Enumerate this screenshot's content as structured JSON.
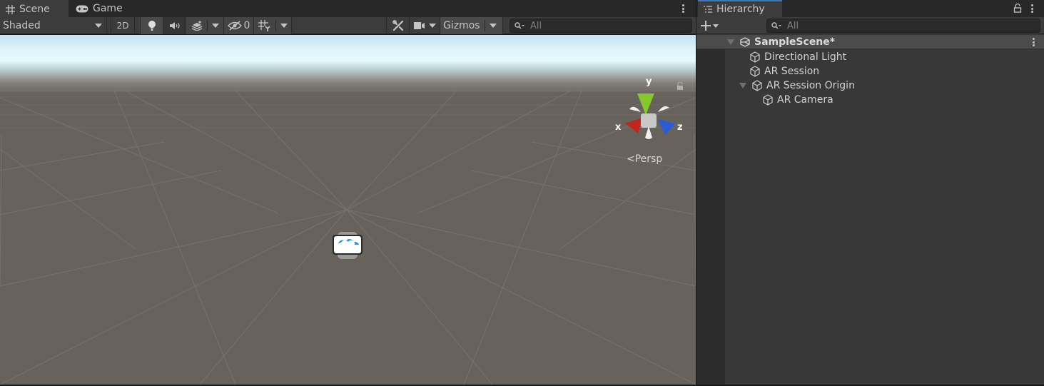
{
  "scene_view": {
    "tabs": [
      {
        "label": "Scene",
        "icon": "grid-hash-icon",
        "active": true
      },
      {
        "label": "Game",
        "icon": "gamepad-icon",
        "active": false
      }
    ],
    "toolbar": {
      "draw_mode": "Shaded",
      "mode_2d_label": "2D",
      "hidden_objects_count": "0",
      "gizmos_label": "Gizmos",
      "search_placeholder": "All"
    },
    "orientation_gizmo": {
      "x_label": "x",
      "y_label": "y",
      "z_label": "z",
      "colors": {
        "x": "#c0261b",
        "y": "#83c92a",
        "z": "#2b5cd8"
      },
      "projection_label": "Persp"
    }
  },
  "hierarchy": {
    "tab_label": "Hierarchy",
    "search_placeholder": "All",
    "scene": {
      "name": "SampleScene*"
    },
    "items": [
      {
        "label": "Directional Light",
        "depth": 1,
        "expanded": null
      },
      {
        "label": "AR Session",
        "depth": 1,
        "expanded": null
      },
      {
        "label": "AR Session Origin",
        "depth": 1,
        "expanded": true
      },
      {
        "label": "AR Camera",
        "depth": 2,
        "expanded": null
      }
    ]
  },
  "colors": {
    "accent": "#3a79bb",
    "panel_bg": "#383838",
    "toolbar_bg": "#3c3c3c",
    "ground": "#68625c"
  }
}
